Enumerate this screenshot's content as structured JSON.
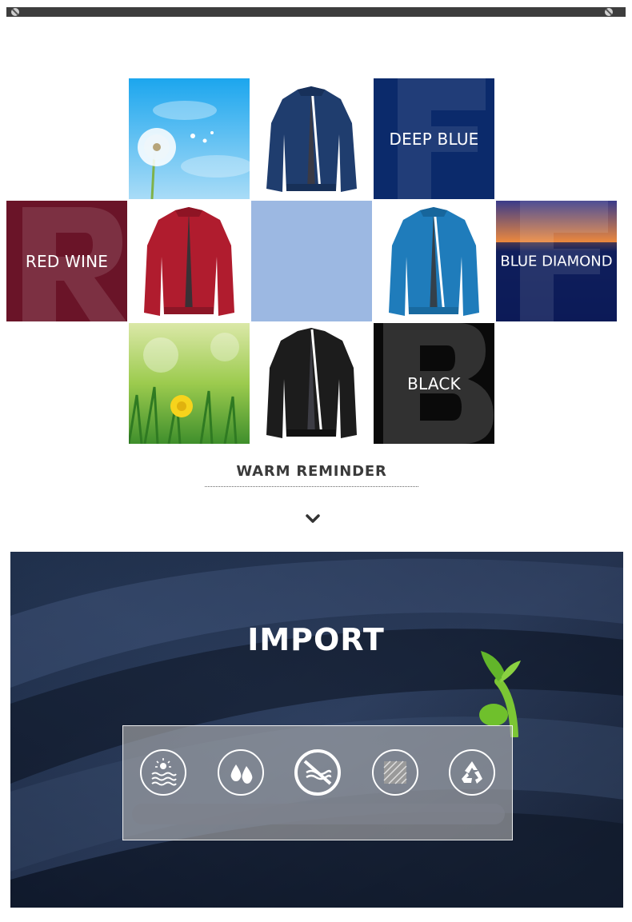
{
  "colors_section": {
    "labels": {
      "deep_blue": "DEEP BLUE",
      "red_wine": "RED WINE",
      "blue_diamond": "BLUE DIAMOND",
      "black": "BLACK"
    },
    "colors": {
      "deep_blue": "#0b2a6b",
      "red_wine": "#6a1428",
      "swatch_light_blue": "#9cb8e2",
      "black": "#0a0a0a",
      "jacket_navy": "#1f3d6e",
      "jacket_red": "#b01c2e",
      "jacket_blue": "#1f7cbb",
      "jacket_black": "#1c1c1c"
    }
  },
  "reminder": {
    "title": "WARM REMINDER"
  },
  "fabric_section": {
    "title": "IMPORT",
    "features": [
      "sun-water-icon",
      "water-drops-icon",
      "no-wash-icon",
      "texture-icon",
      "recycle-icon"
    ]
  }
}
